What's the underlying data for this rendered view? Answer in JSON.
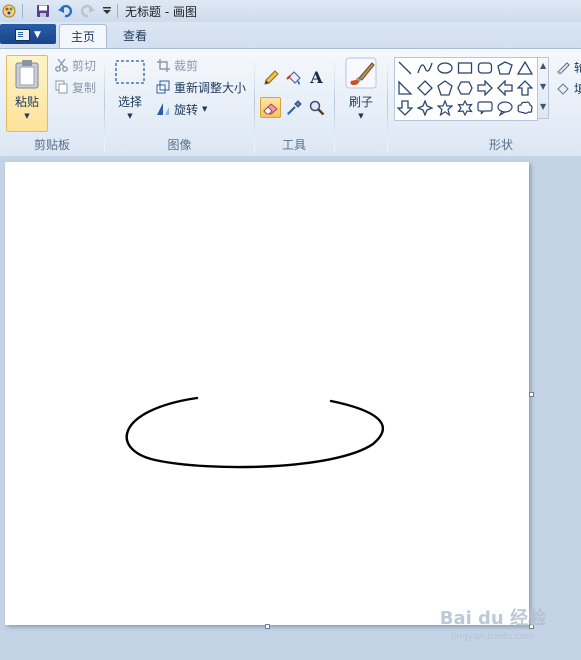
{
  "window": {
    "title": "无标题 - 画图"
  },
  "tabs": [
    {
      "label": "主页",
      "active": true
    },
    {
      "label": "查看",
      "active": false
    }
  ],
  "clipboard": {
    "label": "剪贴板",
    "paste": "粘贴",
    "cut": "剪切",
    "copy": "复制"
  },
  "image": {
    "label": "图像",
    "select": "选择",
    "crop": "裁剪",
    "resize": "重新调整大小",
    "rotate": "旋转"
  },
  "tools": {
    "label": "工具",
    "items": [
      "pencil-icon",
      "fill-icon",
      "text-icon",
      "eraser-icon",
      "color-picker-icon",
      "magnifier-icon"
    ],
    "selected": "eraser-icon"
  },
  "brushes": {
    "label": "刷子"
  },
  "shapes": {
    "label": "形状",
    "items": [
      "line",
      "curve",
      "oval",
      "rectangle",
      "rounded-rectangle",
      "polygon",
      "triangle",
      "right-triangle",
      "diamond",
      "pentagon",
      "hexagon",
      "right-arrow",
      "left-arrow",
      "up-arrow",
      "down-arrow",
      "four-point-star",
      "five-point-star",
      "six-point-star",
      "rounded-callout",
      "oval-callout",
      "cloud-callout"
    ],
    "outline_partial": "轮",
    "fill_partial": "填"
  },
  "watermark": {
    "main": "Bai du 经验",
    "sub": "jingyan.baidu.com"
  },
  "colors": {
    "accent": "#2a5ea8",
    "canvas": "#ffffff",
    "workspace": "#c5d3e6"
  }
}
